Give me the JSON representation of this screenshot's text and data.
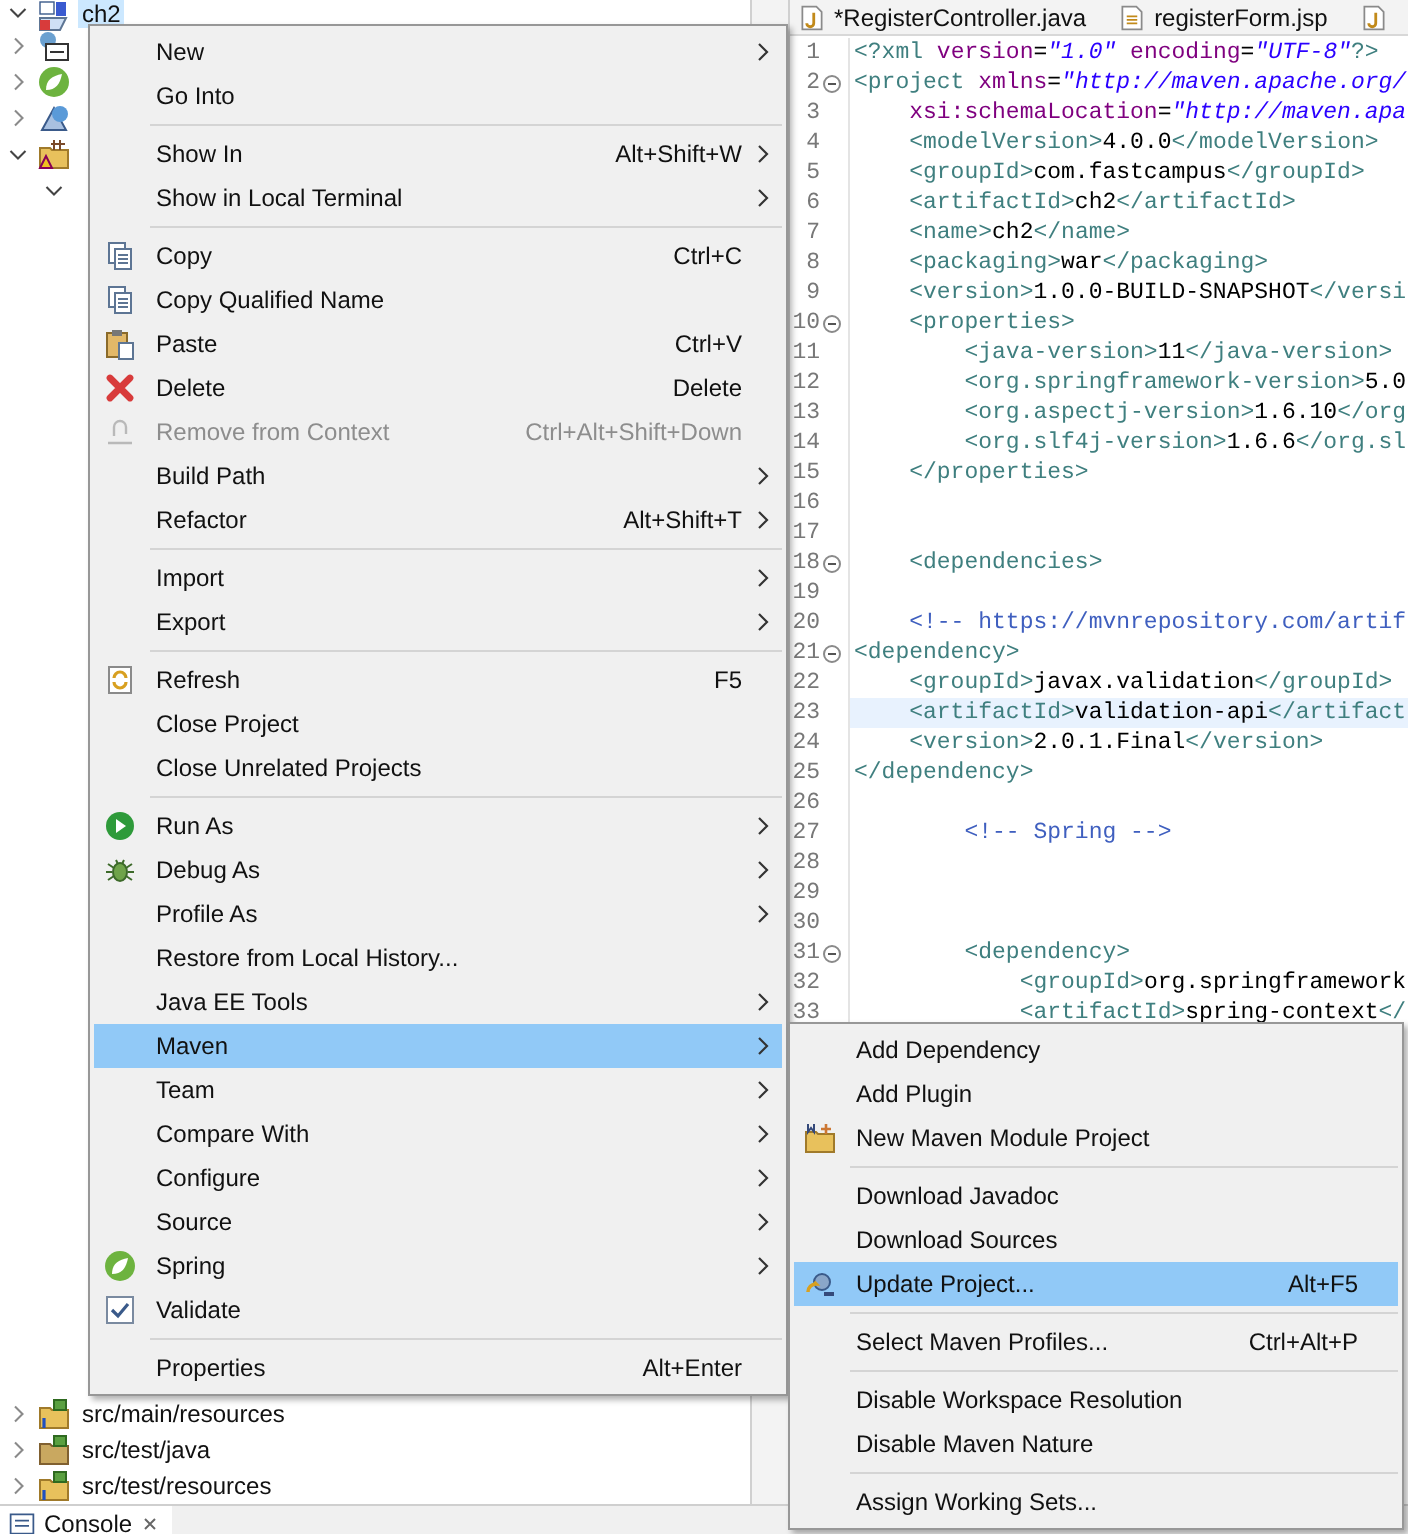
{
  "project_tree": {
    "top": [
      {
        "label": "ch2",
        "kind": "project",
        "expanded": true,
        "selected": true,
        "children": [
          {
            "kind": "deploy",
            "expanded": false
          },
          {
            "kind": "spring",
            "expanded": false
          },
          {
            "kind": "webservice",
            "expanded": false
          },
          {
            "kind": "folder-warning",
            "expanded": true,
            "children": [
              {
                "expanded": true
              }
            ]
          }
        ]
      }
    ],
    "bottom": [
      {
        "label": "src/main/resources",
        "kind": "source-folder-info",
        "expanded": false
      },
      {
        "label": "src/test/java",
        "kind": "source-folder",
        "expanded": false
      },
      {
        "label": "src/test/resources",
        "kind": "source-folder-info",
        "expanded": false
      }
    ]
  },
  "editor": {
    "tabs": [
      {
        "label": "*RegisterController.java",
        "kind": "java"
      },
      {
        "label": "registerForm.jsp",
        "kind": "jsp"
      },
      {
        "kind": "java"
      }
    ],
    "lines": [
      {
        "number": "1",
        "fold": false,
        "current": false,
        "segments": [
          {
            "kind": "tag",
            "text": "<?xml "
          },
          {
            "kind": "attr",
            "text": "version"
          },
          {
            "kind": "text",
            "text": "="
          },
          {
            "kind": "value",
            "text": "\"1.0\""
          },
          {
            "kind": "attr",
            "text": " encoding"
          },
          {
            "kind": "text",
            "text": "="
          },
          {
            "kind": "value",
            "text": "\"UTF-8\""
          },
          {
            "kind": "tag",
            "text": "?>"
          }
        ]
      },
      {
        "number": "2",
        "fold": true,
        "current": false,
        "segments": [
          {
            "kind": "tag",
            "text": "<project"
          },
          {
            "kind": "attr",
            "text": " xmlns"
          },
          {
            "kind": "text",
            "text": "="
          },
          {
            "kind": "value",
            "text": "\"http://maven.apache.org/"
          }
        ]
      },
      {
        "number": "3",
        "fold": false,
        "current": false,
        "segments": [
          {
            "kind": "attr",
            "text": "    xsi:schemaLocation"
          },
          {
            "kind": "text",
            "text": "="
          },
          {
            "kind": "value",
            "text": "\"http://maven.apa"
          }
        ]
      },
      {
        "number": "4",
        "fold": false,
        "current": false,
        "segments": [
          {
            "kind": "tag",
            "text": "    <modelVersion>"
          },
          {
            "kind": "text",
            "text": "4.0.0"
          },
          {
            "kind": "tag",
            "text": "</modelVersion>"
          }
        ]
      },
      {
        "number": "5",
        "fold": false,
        "current": false,
        "segments": [
          {
            "kind": "tag",
            "text": "    <groupId>"
          },
          {
            "kind": "text",
            "text": "com.fastcampus"
          },
          {
            "kind": "tag",
            "text": "</groupId>"
          }
        ]
      },
      {
        "number": "6",
        "fold": false,
        "current": false,
        "segments": [
          {
            "kind": "tag",
            "text": "    <artifactId>"
          },
          {
            "kind": "text",
            "text": "ch2"
          },
          {
            "kind": "tag",
            "text": "</artifactId>"
          }
        ]
      },
      {
        "number": "7",
        "fold": false,
        "current": false,
        "segments": [
          {
            "kind": "tag",
            "text": "    <name>"
          },
          {
            "kind": "text",
            "text": "ch2"
          },
          {
            "kind": "tag",
            "text": "</name>"
          }
        ]
      },
      {
        "number": "8",
        "fold": false,
        "current": false,
        "segments": [
          {
            "kind": "tag",
            "text": "    <packaging>"
          },
          {
            "kind": "text",
            "text": "war"
          },
          {
            "kind": "tag",
            "text": "</packaging>"
          }
        ]
      },
      {
        "number": "9",
        "fold": false,
        "current": false,
        "segments": [
          {
            "kind": "tag",
            "text": "    <version>"
          },
          {
            "kind": "text",
            "text": "1.0.0-BUILD-SNAPSHOT"
          },
          {
            "kind": "tag",
            "text": "</versi"
          }
        ]
      },
      {
        "number": "10",
        "fold": true,
        "current": false,
        "segments": [
          {
            "kind": "tag",
            "text": "    <properties>"
          }
        ]
      },
      {
        "number": "11",
        "fold": false,
        "current": false,
        "segments": [
          {
            "kind": "tag",
            "text": "        <java-version>"
          },
          {
            "kind": "text",
            "text": "11"
          },
          {
            "kind": "tag",
            "text": "</java-version>"
          }
        ]
      },
      {
        "number": "12",
        "fold": false,
        "current": false,
        "segments": [
          {
            "kind": "tag",
            "text": "        <org.springframework-version>"
          },
          {
            "kind": "text",
            "text": "5.0"
          }
        ]
      },
      {
        "number": "13",
        "fold": false,
        "current": false,
        "segments": [
          {
            "kind": "tag",
            "text": "        <org.aspectj-version>"
          },
          {
            "kind": "text",
            "text": "1.6.10"
          },
          {
            "kind": "tag",
            "text": "</org"
          }
        ]
      },
      {
        "number": "14",
        "fold": false,
        "current": false,
        "segments": [
          {
            "kind": "tag",
            "text": "        <org.slf4j-version>"
          },
          {
            "kind": "text",
            "text": "1.6.6"
          },
          {
            "kind": "tag",
            "text": "</org.sl"
          }
        ]
      },
      {
        "number": "15",
        "fold": false,
        "current": false,
        "segments": [
          {
            "kind": "tag",
            "text": "    </properties>"
          }
        ]
      },
      {
        "number": "16",
        "fold": false,
        "current": false
      },
      {
        "number": "17",
        "fold": false,
        "current": false
      },
      {
        "number": "18",
        "fold": true,
        "current": false,
        "segments": [
          {
            "kind": "tag",
            "text": "    <dependencies>"
          }
        ]
      },
      {
        "number": "19",
        "fold": false,
        "current": false
      },
      {
        "number": "20",
        "fold": false,
        "current": false,
        "segments": [
          {
            "kind": "comment",
            "text": "    <!-- https://mvnrepository.com/artif"
          }
        ]
      },
      {
        "number": "21",
        "fold": true,
        "current": false,
        "segments": [
          {
            "kind": "tag",
            "text": "<dependency>"
          }
        ]
      },
      {
        "number": "22",
        "fold": false,
        "current": false,
        "segments": [
          {
            "kind": "tag",
            "text": "    <groupId>"
          },
          {
            "kind": "text",
            "text": "javax.validation"
          },
          {
            "kind": "tag",
            "text": "</groupId>"
          }
        ]
      },
      {
        "number": "23",
        "fold": false,
        "current": true,
        "segments": [
          {
            "kind": "tag",
            "text": "    <artifactId>"
          },
          {
            "kind": "text",
            "text": "validation-api"
          },
          {
            "kind": "tag",
            "text": "</artifact"
          }
        ]
      },
      {
        "number": "24",
        "fold": false,
        "current": false,
        "segments": [
          {
            "kind": "tag",
            "text": "    <version>"
          },
          {
            "kind": "text",
            "text": "2.0.1.Final"
          },
          {
            "kind": "tag",
            "text": "</version>"
          }
        ]
      },
      {
        "number": "25",
        "fold": false,
        "current": false,
        "segments": [
          {
            "kind": "tag",
            "text": "</dependency>"
          }
        ]
      },
      {
        "number": "26",
        "fold": false,
        "current": false
      },
      {
        "number": "27",
        "fold": false,
        "current": false,
        "segments": [
          {
            "kind": "comment",
            "text": "        <!-- Spring -->"
          }
        ]
      },
      {
        "number": "28",
        "fold": false,
        "current": false
      },
      {
        "number": "29",
        "fold": false,
        "current": false
      },
      {
        "number": "30",
        "fold": false,
        "current": false
      },
      {
        "number": "31",
        "fold": true,
        "current": false,
        "segments": [
          {
            "kind": "tag",
            "text": "        <dependency>"
          }
        ]
      },
      {
        "number": "32",
        "fold": false,
        "current": false,
        "segments": [
          {
            "kind": "tag",
            "text": "            <groupId>"
          },
          {
            "kind": "text",
            "text": "org.springframework"
          }
        ]
      },
      {
        "number": "33",
        "fold": false,
        "current": false,
        "segments": [
          {
            "kind": "tag",
            "text": "            <artifactId>"
          },
          {
            "kind": "text",
            "text": "spring-context"
          },
          {
            "kind": "tag",
            "text": "</"
          }
        ]
      }
    ]
  },
  "context_menu": {
    "groups": [
      [
        {
          "label": "New",
          "kind": "plain",
          "submenu": true,
          "disabled": false,
          "selected": false
        },
        {
          "label": "Go Into",
          "kind": "plain",
          "submenu": false,
          "disabled": false,
          "selected": false
        }
      ],
      [
        {
          "label": "Show In",
          "kind": "plain",
          "shortcut": "Alt+Shift+W",
          "submenu": true,
          "disabled": false,
          "selected": false
        },
        {
          "label": "Show in Local Terminal",
          "kind": "plain",
          "submenu": true,
          "disabled": false,
          "selected": false
        }
      ],
      [
        {
          "label": "Copy",
          "kind": "copy",
          "shortcut": "Ctrl+C",
          "submenu": false,
          "disabled": false,
          "selected": false
        },
        {
          "label": "Copy Qualified Name",
          "kind": "copy",
          "submenu": false,
          "disabled": false,
          "selected": false
        },
        {
          "label": "Paste",
          "kind": "paste",
          "shortcut": "Ctrl+V",
          "submenu": false,
          "disabled": false,
          "selected": false
        },
        {
          "label": "Delete",
          "kind": "delete",
          "shortcut": "Delete",
          "submenu": false,
          "disabled": false,
          "selected": false
        },
        {
          "label": "Remove from Context",
          "kind": "remove",
          "shortcut": "Ctrl+Alt+Shift+Down",
          "submenu": false,
          "disabled": true,
          "selected": false
        },
        {
          "label": "Build Path",
          "kind": "plain",
          "submenu": true,
          "disabled": false,
          "selected": false
        },
        {
          "label": "Refactor",
          "kind": "plain",
          "shortcut": "Alt+Shift+T",
          "submenu": true,
          "disabled": false,
          "selected": false
        }
      ],
      [
        {
          "label": "Import",
          "kind": "plain",
          "submenu": true,
          "disabled": false,
          "selected": false
        },
        {
          "label": "Export",
          "kind": "plain",
          "submenu": true,
          "disabled": false,
          "selected": false
        }
      ],
      [
        {
          "label": "Refresh",
          "kind": "refresh",
          "shortcut": "F5",
          "submenu": false,
          "disabled": false,
          "selected": false
        },
        {
          "label": "Close Project",
          "kind": "plain",
          "submenu": false,
          "disabled": false,
          "selected": false
        },
        {
          "label": "Close Unrelated Projects",
          "kind": "plain",
          "submenu": false,
          "disabled": false,
          "selected": false
        }
      ],
      [
        {
          "label": "Run As",
          "kind": "run",
          "submenu": true,
          "disabled": false,
          "selected": false
        },
        {
          "label": "Debug As",
          "kind": "debug",
          "submenu": true,
          "disabled": false,
          "selected": false
        },
        {
          "label": "Profile As",
          "kind": "plain",
          "submenu": true,
          "disabled": false,
          "selected": false
        },
        {
          "label": "Restore from Local History...",
          "kind": "plain",
          "submenu": false,
          "disabled": false,
          "selected": false
        },
        {
          "label": "Java EE Tools",
          "kind": "plain",
          "submenu": true,
          "disabled": false,
          "selected": false
        },
        {
          "label": "Maven",
          "kind": "plain",
          "submenu": true,
          "disabled": false,
          "selected": true
        },
        {
          "label": "Team",
          "kind": "plain",
          "submenu": true,
          "disabled": false,
          "selected": false
        },
        {
          "label": "Compare With",
          "kind": "plain",
          "submenu": true,
          "disabled": false,
          "selected": false
        },
        {
          "label": "Configure",
          "kind": "plain",
          "submenu": true,
          "disabled": false,
          "selected": false
        },
        {
          "label": "Source",
          "kind": "plain",
          "submenu": true,
          "disabled": false,
          "selected": false
        },
        {
          "label": "Spring",
          "kind": "spring",
          "submenu": true,
          "disabled": false,
          "selected": false
        },
        {
          "label": "Validate",
          "kind": "check",
          "submenu": false,
          "disabled": false,
          "selected": false
        }
      ],
      [
        {
          "label": "Properties",
          "kind": "plain",
          "shortcut": "Alt+Enter",
          "submenu": false,
          "disabled": false,
          "selected": false
        }
      ]
    ]
  },
  "maven_submenu": {
    "groups": [
      [
        {
          "label": "Add Dependency",
          "kind": "plain",
          "submenu": false,
          "disabled": false,
          "selected": false
        },
        {
          "label": "Add Plugin",
          "kind": "plain",
          "submenu": false,
          "disabled": false,
          "selected": false
        },
        {
          "label": "New Maven Module Project",
          "kind": "maven-module",
          "submenu": false,
          "disabled": false,
          "selected": false
        }
      ],
      [
        {
          "label": "Download Javadoc",
          "kind": "plain",
          "submenu": false,
          "disabled": false,
          "selected": false
        },
        {
          "label": "Download Sources",
          "kind": "plain",
          "submenu": false,
          "disabled": false,
          "selected": false
        },
        {
          "label": "Update Project...",
          "kind": "update",
          "shortcut": "Alt+F5",
          "submenu": false,
          "disabled": false,
          "selected": true
        }
      ],
      [
        {
          "label": "Select Maven Profiles...",
          "kind": "plain",
          "shortcut": "Ctrl+Alt+P",
          "submenu": false,
          "disabled": false,
          "selected": false
        }
      ],
      [
        {
          "label": "Disable Workspace Resolution",
          "kind": "plain",
          "submenu": false,
          "disabled": false,
          "selected": false
        },
        {
          "label": "Disable Maven Nature",
          "kind": "plain",
          "submenu": false,
          "disabled": false,
          "selected": false
        }
      ],
      [
        {
          "label": "Assign Working Sets...",
          "kind": "plain",
          "submenu": false,
          "disabled": false,
          "selected": false
        }
      ]
    ]
  },
  "bottom_panel": {
    "tabs": [
      {
        "label": "Console"
      }
    ]
  }
}
